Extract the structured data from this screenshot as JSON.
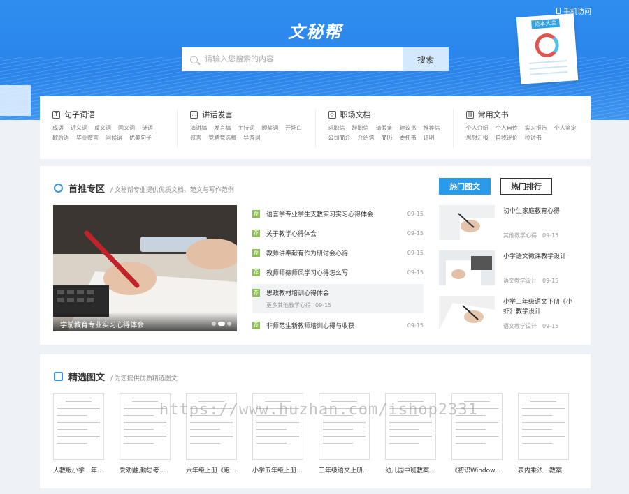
{
  "header": {
    "mobile_link": "手机访问",
    "logo": "文秘帮",
    "search_placeholder": "请输入您搜索的内容",
    "search_button": "搜索",
    "deco_book_title": "范本大全"
  },
  "categories": [
    {
      "icon": "text-icon",
      "title": "句子词语",
      "links": [
        "成语",
        "近义词",
        "反义词",
        "同义词",
        "谜语",
        "歇后语",
        "毕业赠言",
        "问候语",
        "优美句子"
      ]
    },
    {
      "icon": "speech-icon",
      "title": "讲话发言",
      "links": [
        "演讲稿",
        "发言稿",
        "主持词",
        "颁奖词",
        "开场白",
        "慰言",
        "竞聘竞选稿",
        "导游词"
      ]
    },
    {
      "icon": "briefcase-icon",
      "title": "职场文档",
      "links": [
        "求职信",
        "辞职信",
        "请假条",
        "建议书",
        "推荐信",
        "公司简介",
        "介绍信",
        "简历",
        "委托书",
        "证明"
      ]
    },
    {
      "icon": "document-icon",
      "title": "常用文书",
      "links": [
        "个人介绍",
        "个人自传",
        "实习报告",
        "个人鉴定",
        "思想汇报",
        "自我评价",
        "检讨书"
      ]
    }
  ],
  "featured": {
    "title": "首推专区",
    "subtitle": "/ 文秘帮专业提供优质文档、范文与写作范例",
    "hero_caption": "学前教育专业实习心得体会",
    "tag_label": "荐",
    "articles": [
      {
        "title": "语言学专业学生支教实习实习心得体会",
        "date": "09-15"
      },
      {
        "title": "关于教学心得体会",
        "date": "09-15"
      },
      {
        "title": "教师讲奉献有作为研讨会心得",
        "date": "09-15"
      },
      {
        "title": "教师师德师风学习心得怎么写",
        "date": "09-15"
      }
    ],
    "active_article": {
      "title": "思政教材培训心得体会",
      "more": "更多其他教学心得",
      "date": "09-15"
    },
    "last_article": {
      "title": "非师范生新教师培训心得与收获",
      "date": "09-15"
    },
    "tabs": [
      "热门图文",
      "热门排行"
    ],
    "hot": [
      {
        "title": "初中生家庭教育心得",
        "meta": "其他教学心得",
        "date": "09-15"
      },
      {
        "title": "小学语文微课教学设计",
        "meta": "语文教学设计",
        "date": "09-15"
      },
      {
        "title": "小学三年级语文下册《小虾》教学设计",
        "meta": "语文教学设计",
        "date": "09-15"
      }
    ]
  },
  "picks": {
    "title": "精选图文",
    "subtitle": "/ 为您提供优质精选图文",
    "docs": [
      "人教版小学一年...",
      "爱劝鼬,勤思考...",
      "六年级上册《跑...",
      "小学五年级上册...",
      "三年级语文上册...",
      "幼儿园中班教案...",
      "《初识Window...",
      "表内乘法一教案"
    ]
  },
  "watermark": "https://www.huzhan.com/ishop2331",
  "colors": {
    "primary": "#2a84ea",
    "tab_active": "#2a9be8",
    "tag_green": "#8cc152"
  }
}
